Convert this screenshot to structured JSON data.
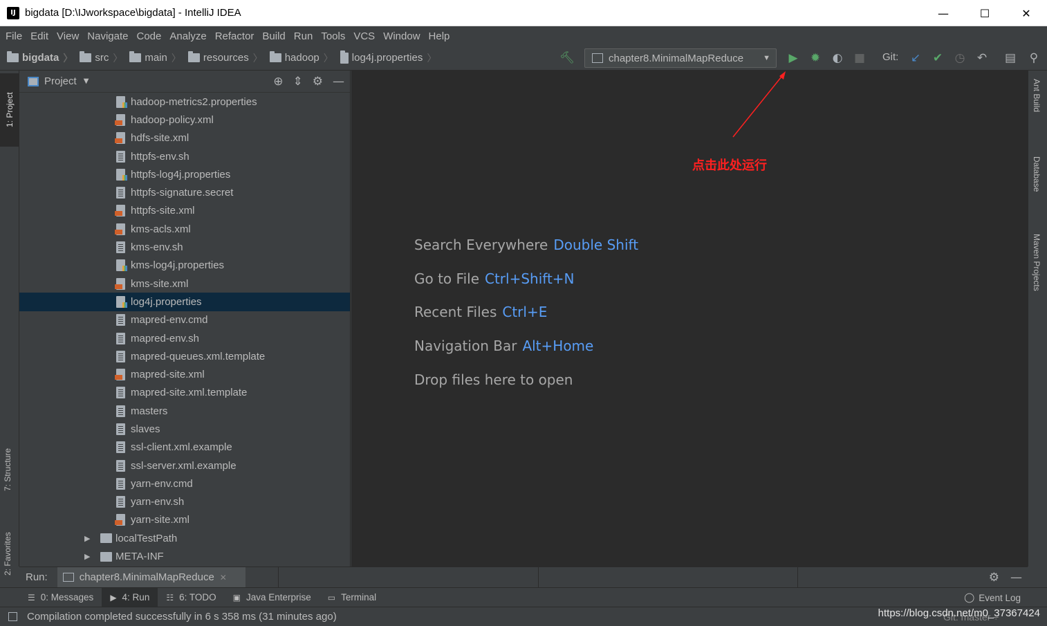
{
  "window": {
    "title": "bigdata [D:\\IJworkspace\\bigdata] - IntelliJ IDEA",
    "app_icon": "IJ",
    "minimize": "—",
    "maximize": "☐",
    "close": "✕"
  },
  "menu": [
    "File",
    "Edit",
    "View",
    "Navigate",
    "Code",
    "Analyze",
    "Refactor",
    "Build",
    "Run",
    "Tools",
    "VCS",
    "Window",
    "Help"
  ],
  "breadcrumb": [
    "bigdata",
    "src",
    "main",
    "resources",
    "hadoop",
    "log4j.properties"
  ],
  "toolbar": {
    "run_config": "chapter8.MinimalMapReduce",
    "git_label": "Git:"
  },
  "left_strip": {
    "project": "1: Project",
    "structure": "7: Structure",
    "favorites": "2: Favorites"
  },
  "right_strip": {
    "ant": "Ant Build",
    "database": "Database",
    "maven": "Maven Projects"
  },
  "project_panel": {
    "title": "Project",
    "files": [
      {
        "name": "hadoop-metrics2.properties",
        "type": "prop"
      },
      {
        "name": "hadoop-policy.xml",
        "type": "xml"
      },
      {
        "name": "hdfs-site.xml",
        "type": "xml"
      },
      {
        "name": "httpfs-env.sh",
        "type": "plain"
      },
      {
        "name": "httpfs-log4j.properties",
        "type": "prop"
      },
      {
        "name": "httpfs-signature.secret",
        "type": "plain"
      },
      {
        "name": "httpfs-site.xml",
        "type": "xml"
      },
      {
        "name": "kms-acls.xml",
        "type": "xml"
      },
      {
        "name": "kms-env.sh",
        "type": "plain"
      },
      {
        "name": "kms-log4j.properties",
        "type": "prop"
      },
      {
        "name": "kms-site.xml",
        "type": "xml"
      },
      {
        "name": "log4j.properties",
        "type": "prop"
      },
      {
        "name": "mapred-env.cmd",
        "type": "plain"
      },
      {
        "name": "mapred-env.sh",
        "type": "plain"
      },
      {
        "name": "mapred-queues.xml.template",
        "type": "plain"
      },
      {
        "name": "mapred-site.xml",
        "type": "xml"
      },
      {
        "name": "mapred-site.xml.template",
        "type": "plain"
      },
      {
        "name": "masters",
        "type": "plain"
      },
      {
        "name": "slaves",
        "type": "plain"
      },
      {
        "name": "ssl-client.xml.example",
        "type": "plain"
      },
      {
        "name": "ssl-server.xml.example",
        "type": "plain"
      },
      {
        "name": "yarn-env.cmd",
        "type": "plain"
      },
      {
        "name": "yarn-env.sh",
        "type": "plain"
      },
      {
        "name": "yarn-site.xml",
        "type": "xml"
      }
    ],
    "folders": [
      "localTestPath",
      "META-INF"
    ]
  },
  "editor": {
    "hints": [
      {
        "label": "Search Everywhere",
        "key": "Double Shift"
      },
      {
        "label": "Go to File",
        "key": "Ctrl+Shift+N"
      },
      {
        "label": "Recent Files",
        "key": "Ctrl+E"
      },
      {
        "label": "Navigation Bar",
        "key": "Alt+Home"
      },
      {
        "label": "Drop files here to open",
        "key": ""
      }
    ],
    "annotation": "点击此处运行"
  },
  "run_window": {
    "label": "Run:",
    "tab": "chapter8.MinimalMapReduce"
  },
  "bottom_tabs": [
    "0: Messages",
    "4: Run",
    "6: TODO",
    "Java Enterprise",
    "Terminal"
  ],
  "event_log": "Event Log",
  "status": {
    "message": "Compilation completed successfully in 6 s 358 ms (31 minutes ago)",
    "git_branch": "Git: master ÷",
    "watermark": "https://blog.csdn.net/m0_37367424"
  },
  "colors": {
    "accent": "#589df6",
    "run_green": "#59a869",
    "annotation_red": "#ff2020",
    "selection": "#0d293e"
  }
}
